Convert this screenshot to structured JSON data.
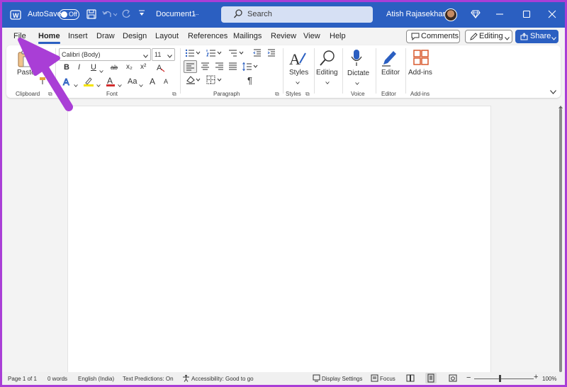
{
  "titlebar": {
    "autosave_label": "AutoSave",
    "autosave_state": "Off",
    "doc_title": "Document1",
    "doc_title_more": "...",
    "search_placeholder": "Search",
    "user_name": "Atish Rajasekharan"
  },
  "menu": {
    "tabs": [
      "File",
      "Home",
      "Insert",
      "Draw",
      "Design",
      "Layout",
      "References",
      "Mailings",
      "Review",
      "View",
      "Help"
    ],
    "active_tab": "Home",
    "comments_label": "Comments",
    "editing_label": "Editing",
    "share_label": "Share"
  },
  "ribbon": {
    "clipboard": {
      "paste_label": "Paste",
      "group_label": "Clipboard"
    },
    "font": {
      "font_name": "Calibri (Body)",
      "font_size": "11",
      "group_label": "Font",
      "bold": "B",
      "italic": "I",
      "underline": "U",
      "strike": "ab",
      "subscript": "x₂",
      "superscript": "x²",
      "change_case": "Aa",
      "grow": "A",
      "shrink": "A"
    },
    "paragraph": {
      "group_label": "Paragraph",
      "pilcrow": "¶"
    },
    "styles": {
      "button_label": "Styles",
      "group_label": "Styles"
    },
    "editing": {
      "button_label": "Editing"
    },
    "voice": {
      "button_label": "Dictate",
      "group_label": "Voice"
    },
    "editor": {
      "button_label": "Editor",
      "group_label": "Editor"
    },
    "addins": {
      "button_label": "Add-ins",
      "group_label": "Add-ins"
    }
  },
  "statusbar": {
    "page": "Page 1 of 1",
    "words": "0 words",
    "language": "English (India)",
    "text_predictions": "Text Predictions: On",
    "accessibility": "Accessibility: Good to go",
    "display_settings": "Display Settings",
    "focus": "Focus",
    "zoom": "100%",
    "zoom_level": 1.0
  },
  "colors": {
    "titlebar": "#2b5fc1",
    "annotation_arrow": "#a93ed6",
    "highlight_yellow": "#f5e400",
    "font_color_red": "#d22d2d"
  }
}
